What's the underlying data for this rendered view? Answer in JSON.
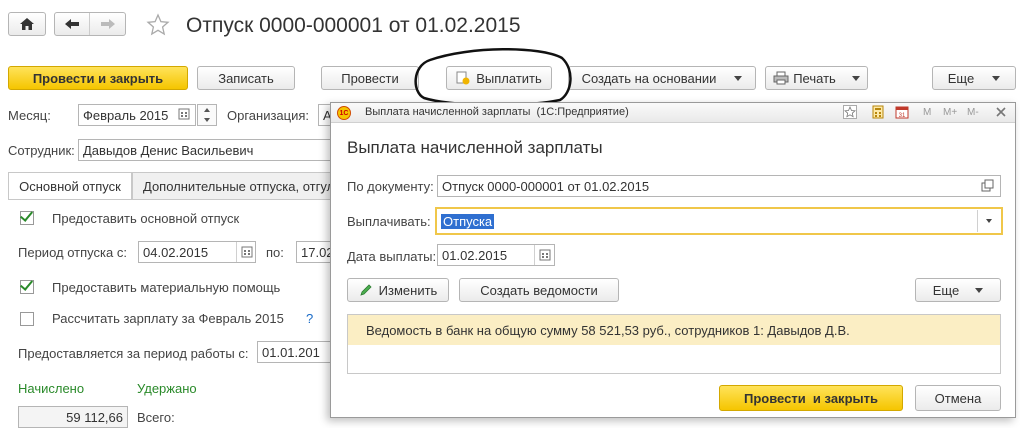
{
  "window": {
    "title": "Отпуск 0000-000001 от 01.02.2015"
  },
  "toolbar": {
    "post_close": "Провести и закрыть",
    "save": "Записать",
    "post": "Провести",
    "pay": "Выплатить",
    "create_based": "Создать на основании",
    "print": "Печать",
    "more": "Еще"
  },
  "form": {
    "month_label": "Месяц:",
    "month_value": "Февраль 2015",
    "org_label": "Организация:",
    "org_value": "А",
    "employee_label": "Сотрудник:",
    "employee_value": "Давыдов Денис Васильевич",
    "tabs": [
      "Основной отпуск",
      "Дополнительные отпуска, отгул"
    ],
    "grant_main_label": "Предоставить основной отпуск",
    "period_label": "Период отпуска с:",
    "period_from": "04.02.2015",
    "period_to_label": "по:",
    "period_to": "17.02",
    "material_help_label": "Предоставить материальную помощь",
    "calc_salary_label": "Рассчитать зарплату за Февраль 2015",
    "help_mark": "?",
    "work_period_label": "Предоставляется за период работы с:",
    "work_period_value": "01.01.201",
    "accrued_label": "Начислено",
    "withheld_label": "Удержано",
    "accrued_value": "59 112,66",
    "total_label": "Всего:"
  },
  "dialog": {
    "caption": "Выплата начисленной зарплаты  (1С:Предприятие)",
    "caption_buttons": [
      "M",
      "M+",
      "M-"
    ],
    "heading": "Выплата начисленной зарплаты",
    "doc_label": "По документу:",
    "doc_value": "Отпуск 0000-000001 от 01.02.2015",
    "pay_label": "Выплачивать:",
    "pay_value": "Отпуска",
    "date_label": "Дата выплаты:",
    "date_value": "01.02.2015",
    "edit_button": "Изменить",
    "create_statements_button": "Создать ведомости",
    "more_button": "Еще",
    "statement_row": "Ведомость в банк на общую сумму 58 521,53 руб., сотрудников 1: Давыдов Д.В.",
    "post_close_button": "Провести  и закрыть",
    "cancel_button": "Отмена"
  }
}
